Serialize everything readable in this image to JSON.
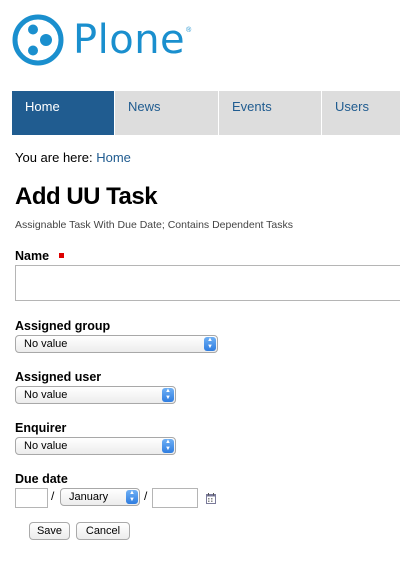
{
  "logo": {
    "text": "Plone",
    "registered": "®"
  },
  "nav": [
    "Home",
    "News",
    "Events",
    "Users"
  ],
  "breadcrumb": {
    "prefix": "You are here:",
    "link": "Home"
  },
  "form": {
    "title": "Add UU Task",
    "description": "Assignable Task With Due Date; Contains Dependent Tasks",
    "name_label": "Name",
    "name_value": "",
    "assigned_group_label": "Assigned group",
    "assigned_group_value": "No value",
    "assigned_user_label": "Assigned user",
    "assigned_user_value": "No value",
    "enquirer_label": "Enquirer",
    "enquirer_value": "No value",
    "due_date_label": "Due date",
    "due_day": "",
    "due_month": "January",
    "due_year": "",
    "date_separator": "/",
    "save_label": "Save",
    "cancel_label": "Cancel"
  },
  "colors": {
    "brand": "#1a8fce",
    "nav_active": "#205c90",
    "nav_inactive": "#dddddd",
    "required": "#dd0000"
  }
}
